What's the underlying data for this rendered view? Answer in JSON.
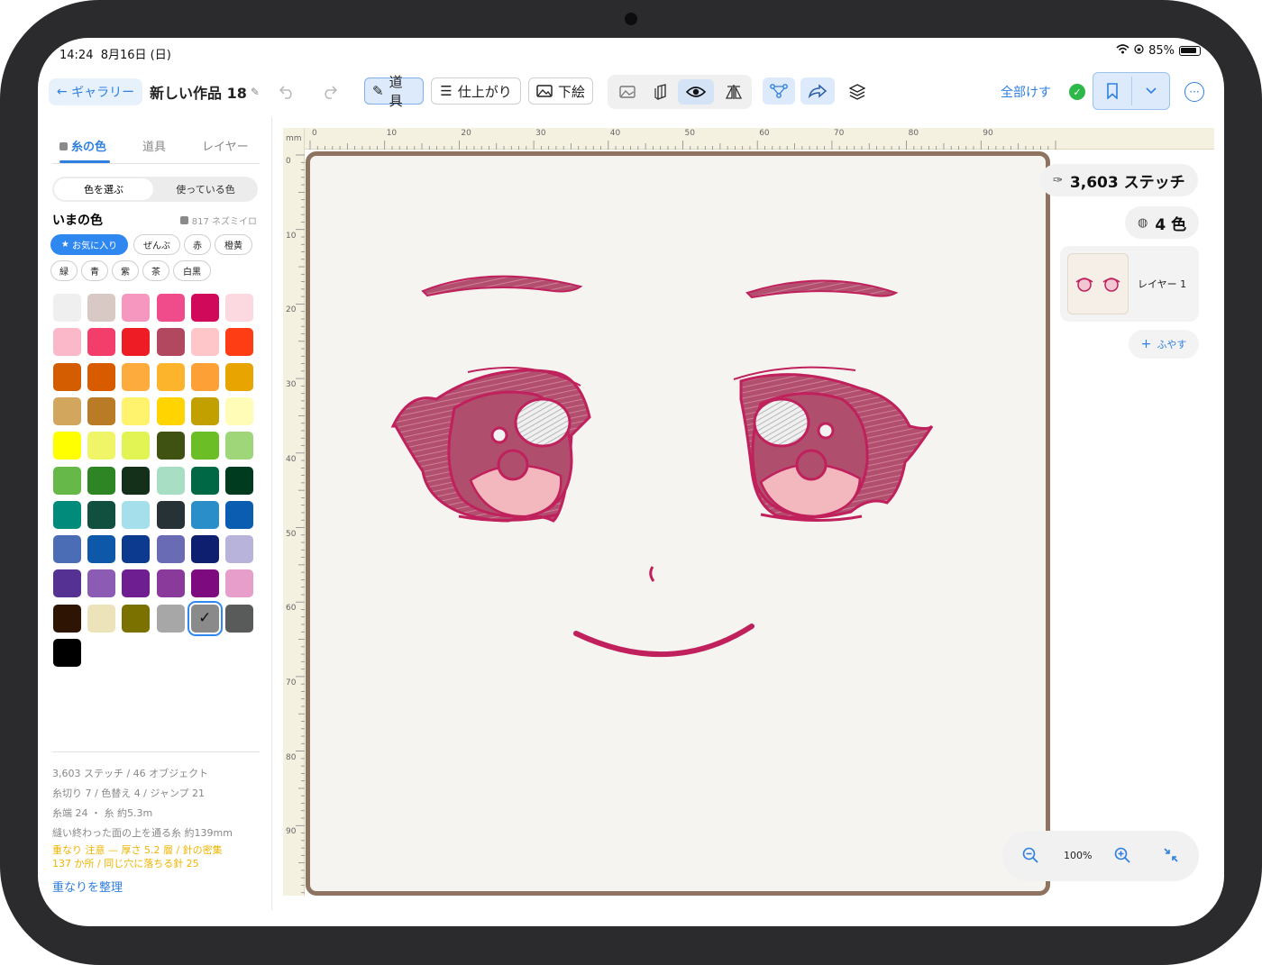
{
  "status": {
    "time": "14:24",
    "date": "8月16日 (日)",
    "battery": "85%"
  },
  "toolbar": {
    "back_label": "ギャラリー",
    "project_title": "新しい作品 18",
    "tool_label": "道具",
    "finish_label": "仕上がり",
    "underlay_label": "下絵",
    "erase_all_label": "全部けす"
  },
  "panel": {
    "tabs": [
      "糸の色",
      "道具",
      "レイヤー"
    ],
    "segments": [
      "色を選ぶ",
      "使っている色"
    ],
    "current_title": "いまの色",
    "current_color_name": "817 ネズミイロ",
    "filters": [
      "お気に入り",
      "ぜんぶ",
      "赤",
      "橙黄",
      "緑",
      "青",
      "紫",
      "茶",
      "白黒"
    ],
    "swatches": [
      "#efefef",
      "#d9c9c5",
      "#f597bf",
      "#f04b8b",
      "#d0095a",
      "#fcd8e0",
      "#fbb8c8",
      "#f33d6a",
      "#ee1c24",
      "#b1485f",
      "#fec6c9",
      "#ff3d14",
      "#d35d00",
      "#d95b00",
      "#feab3e",
      "#fdb42d",
      "#fda136",
      "#e8a400",
      "#d2a65d",
      "#b97b26",
      "#fff26d",
      "#ffd400",
      "#c2a000",
      "#fffcb7",
      "#ffff00",
      "#f0f567",
      "#e2f354",
      "#3f5211",
      "#6bbe26",
      "#9ed679",
      "#66b849",
      "#2e8524",
      "#14301a",
      "#a8dfc4",
      "#006845",
      "#003a1f",
      "#008b7b",
      "#11503e",
      "#a6dfec",
      "#273237",
      "#2a8ec9",
      "#0a5db1",
      "#4a6db6",
      "#0e58a9",
      "#0c3a8f",
      "#6a6bb5",
      "#0e1f6f",
      "#b8b3da",
      "#553194",
      "#8c5bb4",
      "#6f1e91",
      "#8a3a9a",
      "#7d0a7f",
      "#e89ecb",
      "#2d1403",
      "#ede3bb",
      "#7a7100",
      "#a7a7a7",
      "#8a8a8a",
      "#595a5a",
      "#000000"
    ],
    "selected_swatch": 58,
    "check_glyph": "✓",
    "stats": [
      "3,603 ステッチ / 46 オブジェクト",
      "糸切り 7 / 色替え 4 / ジャンプ 21",
      "糸端 24 ・ 糸 約5.3m",
      "縫い終わった面の上を通る糸 約139mm"
    ],
    "warnings": [
      "重なり 注意 — 厚さ 5.2 層 / 針の密集",
      "137 か所 / 同じ穴に落ちる針 25"
    ],
    "tidy_label": "重なりを整理"
  },
  "canvas": {
    "unit": "mm",
    "x_ticks": [
      "0",
      "10",
      "20",
      "30",
      "40",
      "50",
      "60",
      "70",
      "80",
      "90"
    ],
    "y_ticks": [
      "0",
      "10",
      "20",
      "30",
      "40",
      "50",
      "60",
      "70",
      "80",
      "90"
    ],
    "stitch_color": "#c0205c",
    "fill_color": "#b24f6e"
  },
  "info": {
    "stitches": "3,603 ステッチ",
    "colors": "4 色",
    "layer_name": "レイヤー 1",
    "add_label": "ふやす",
    "zoom": "100%"
  },
  "colors": {
    "accent": "#2f7fe0",
    "hoop": "#8e7460",
    "warning": "#f0b400"
  }
}
